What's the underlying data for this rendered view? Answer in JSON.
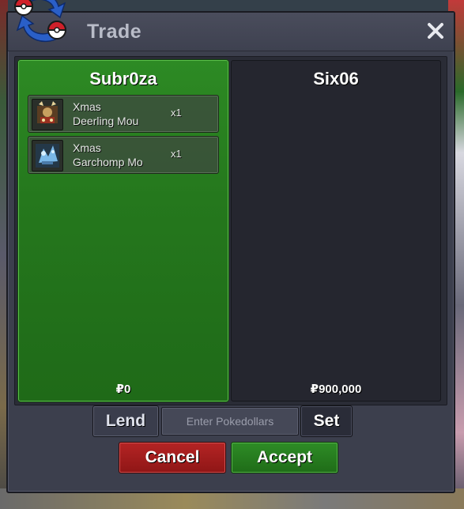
{
  "window": {
    "title": "Trade",
    "close_icon": "close-icon"
  },
  "left_panel": {
    "player_name": "Subr0za",
    "money": "₽0",
    "items": [
      {
        "icon": "deerling-icon",
        "line1": "Xmas",
        "line2": "Deerling Mou",
        "qty": "x1"
      },
      {
        "icon": "garchomp-icon",
        "line1": "Xmas",
        "line2": "Garchomp Mo",
        "qty": "x1"
      }
    ]
  },
  "right_panel": {
    "player_name": "Six06",
    "money": "₽900,000"
  },
  "controls": {
    "lend_label": "Lend",
    "money_placeholder": "Enter Pokedollars",
    "set_label": "Set",
    "cancel_label": "Cancel",
    "accept_label": "Accept"
  },
  "colors": {
    "accent_green": "#2d8a24",
    "cancel_red": "#b42424",
    "window_bg": "#3c3f4d"
  }
}
